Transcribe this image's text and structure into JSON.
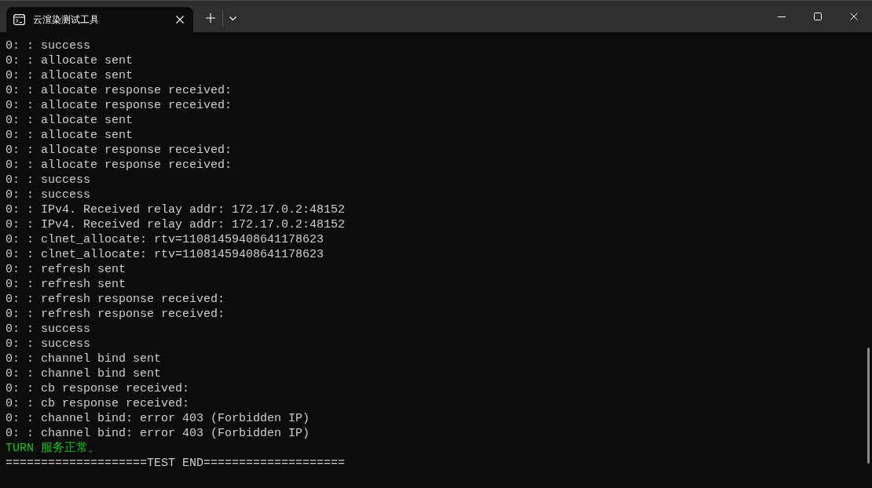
{
  "window": {
    "tabs": [
      {
        "title": "云渲染测试工具",
        "selected": true
      }
    ]
  },
  "terminal": {
    "lines": [
      {
        "kind": "output",
        "text": "0: : success"
      },
      {
        "kind": "output",
        "text": "0: : allocate sent"
      },
      {
        "kind": "output",
        "text": "0: : allocate sent"
      },
      {
        "kind": "output",
        "text": "0: : allocate response received:"
      },
      {
        "kind": "output",
        "text": "0: : allocate response received:"
      },
      {
        "kind": "output",
        "text": "0: : allocate sent"
      },
      {
        "kind": "output",
        "text": "0: : allocate sent"
      },
      {
        "kind": "output",
        "text": "0: : allocate response received:"
      },
      {
        "kind": "output",
        "text": "0: : allocate response received:"
      },
      {
        "kind": "output",
        "text": "0: : success"
      },
      {
        "kind": "output",
        "text": "0: : success"
      },
      {
        "kind": "output",
        "text": "0: : IPv4. Received relay addr: 172.17.0.2:48152"
      },
      {
        "kind": "output",
        "text": "0: : IPv4. Received relay addr: 172.17.0.2:48152"
      },
      {
        "kind": "output",
        "text": "0: : clnet_allocate: rtv=11081459408641178623"
      },
      {
        "kind": "output",
        "text": "0: : clnet_allocate: rtv=11081459408641178623"
      },
      {
        "kind": "output",
        "text": "0: : refresh sent"
      },
      {
        "kind": "output",
        "text": "0: : refresh sent"
      },
      {
        "kind": "output",
        "text": "0: : refresh response received:"
      },
      {
        "kind": "output",
        "text": "0: : refresh response received:"
      },
      {
        "kind": "output",
        "text": "0: : success"
      },
      {
        "kind": "output",
        "text": "0: : success"
      },
      {
        "kind": "output",
        "text": "0: : channel bind sent"
      },
      {
        "kind": "output",
        "text": "0: : channel bind sent"
      },
      {
        "kind": "output",
        "text": "0: : cb response received:"
      },
      {
        "kind": "output",
        "text": "0: : cb response received:"
      },
      {
        "kind": "output",
        "text": "0: : channel bind: error 403 (Forbidden IP)"
      },
      {
        "kind": "output",
        "text": "0: : channel bind: error 403 (Forbidden IP)"
      },
      {
        "kind": "status",
        "text": "TURN 服务正常。"
      },
      {
        "kind": "banner",
        "text": "====================TEST END===================="
      }
    ]
  }
}
